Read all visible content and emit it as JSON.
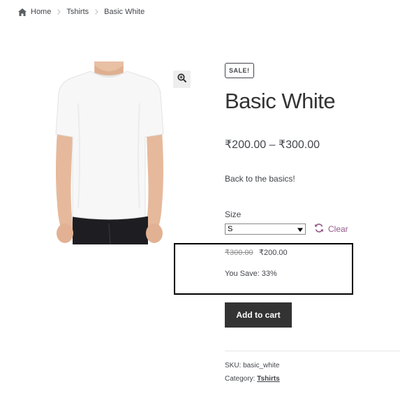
{
  "breadcrumb": {
    "home_icon": "home-icon",
    "items": [
      "Home",
      "Tshirts",
      "Basic White"
    ]
  },
  "product": {
    "badge": "SALE!",
    "title": "Basic White",
    "price_range": "₹200.00 – ₹300.00",
    "short_description": "Back to the basics!",
    "size_label": "Size",
    "size_selected": "S",
    "clear_label": "Clear",
    "variation_price": {
      "regular": "₹300.00",
      "sale": "₹200.00",
      "savings": "You Save: 33%"
    },
    "add_to_cart_label": "Add to cart",
    "sku_label": "SKU:",
    "sku_value": "basic_white",
    "category_label": "Category:",
    "category_value": "Tshirts"
  },
  "icons": {
    "zoom": "zoom-in-icon",
    "clear": "refresh-icon",
    "select_arrow": "caret-down-icon"
  },
  "colors": {
    "link_accent": "#96588a",
    "button_bg": "#333333",
    "highlight_border": "#000000"
  }
}
